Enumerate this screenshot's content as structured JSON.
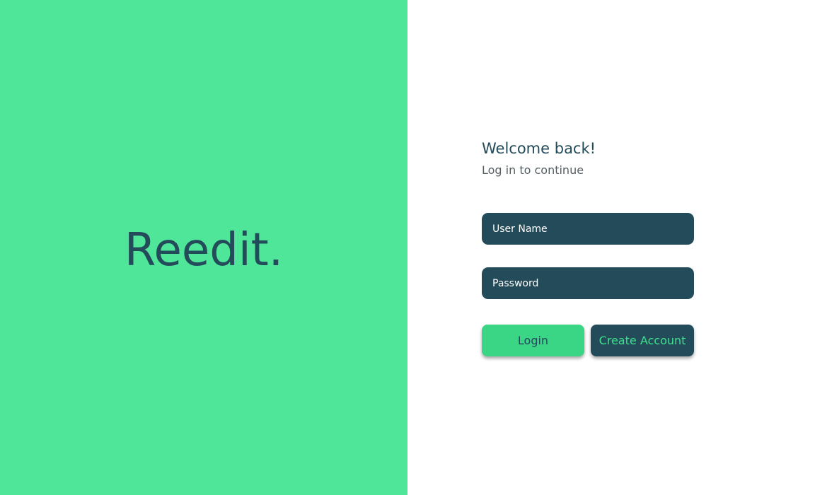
{
  "brand": {
    "logo_text": "Reedit."
  },
  "login": {
    "title": "Welcome back!",
    "subtitle": "Log in to continue",
    "username_placeholder": "User Name",
    "password_placeholder": "Password",
    "login_label": "Login",
    "create_account_label": "Create Account"
  },
  "colors": {
    "brand_green": "#4fe69a",
    "dark_teal": "#234b59",
    "button_green": "#3bd685",
    "accent_green_text": "#3ee08d"
  }
}
